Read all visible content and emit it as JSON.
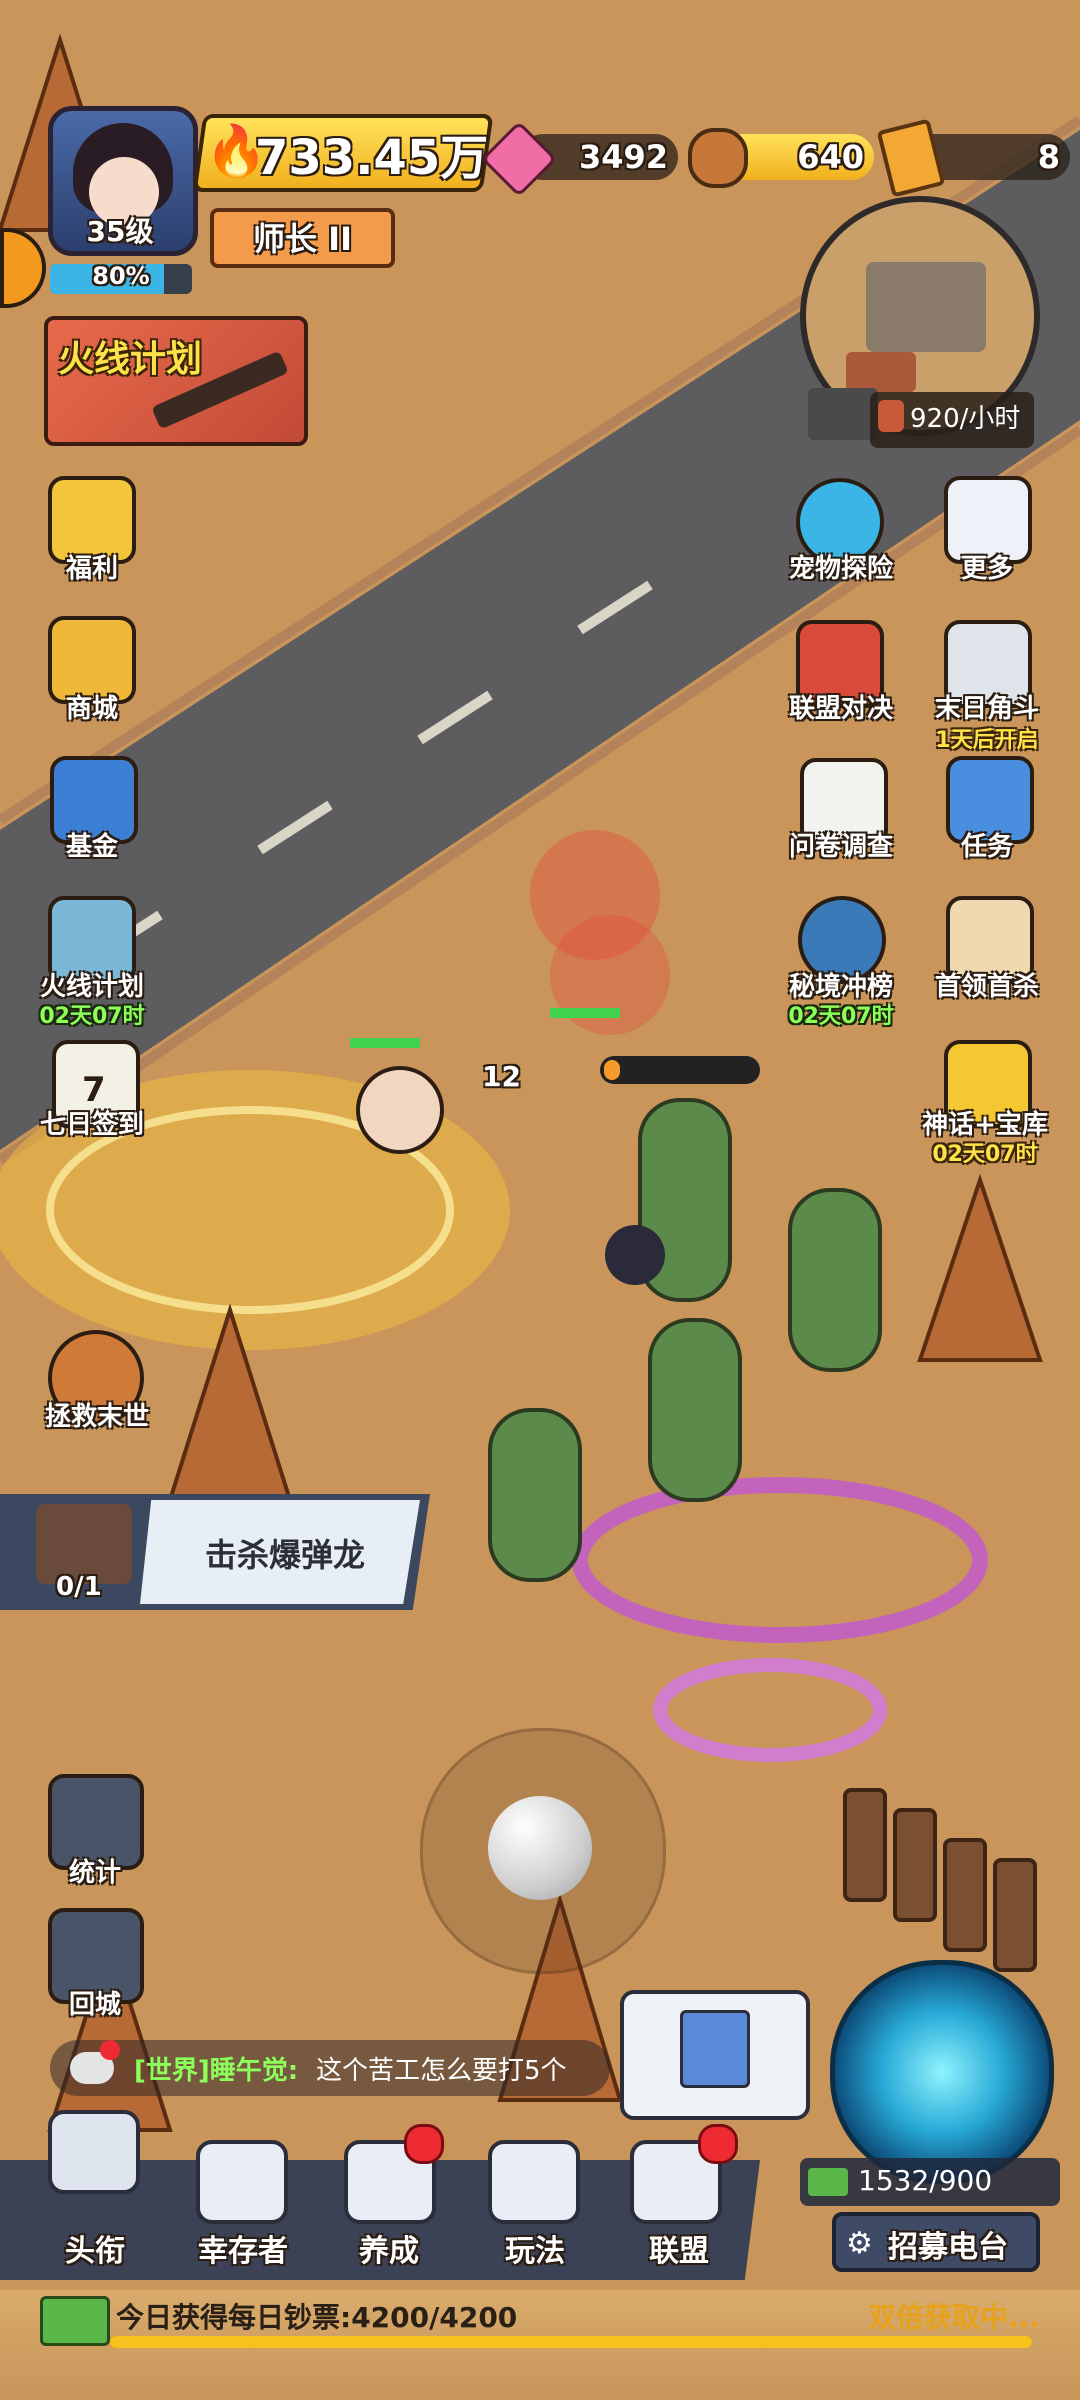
{
  "player": {
    "level": "35级",
    "xp_percent": 80,
    "xp_label": "80%",
    "power": "733.45万",
    "rank": "师长 II"
  },
  "resources": {
    "gems": "3492",
    "wood": "640",
    "tickets": "8"
  },
  "event_banner": {
    "title": "火线计划"
  },
  "left_menu": [
    {
      "label": "福利"
    },
    {
      "label": "商城"
    },
    {
      "label": "基金"
    },
    {
      "label": "火线计划",
      "timer": "02天07时"
    },
    {
      "label": "七日签到"
    }
  ],
  "right_menu": [
    {
      "label": "宠物探险"
    },
    {
      "label": "更多"
    },
    {
      "label": "联盟对决"
    },
    {
      "label": "末日角斗",
      "timer": "1天后开启"
    },
    {
      "label": "问卷调查"
    },
    {
      "label": "任务"
    },
    {
      "label": "秘境冲榜",
      "timer": "02天07时"
    },
    {
      "label": "首领首杀"
    },
    {
      "label": "神话+宝库",
      "timer": "02天07时"
    }
  ],
  "minimap": {
    "rate": "920/小时"
  },
  "rescue": {
    "label": "拯救末世"
  },
  "quest": {
    "text": "击杀爆弹龙",
    "progress": "0/1"
  },
  "battle": {
    "damage": "12"
  },
  "side_tools": [
    {
      "label": "统计"
    },
    {
      "label": "回城"
    }
  ],
  "chat": {
    "channel": "[世界]睡午觉:",
    "message": "这个苦工怎么要打5个"
  },
  "bottom_nav": [
    {
      "label": "头衔",
      "dot": false
    },
    {
      "label": "幸存者",
      "dot": false
    },
    {
      "label": "养成",
      "dot": true
    },
    {
      "label": "玩法",
      "dot": false
    },
    {
      "label": "联盟",
      "dot": true
    }
  ],
  "recruit": {
    "count": "1532/900",
    "button": "招募电台"
  },
  "daily": {
    "text": "今日获得每日钞票:4200/4200",
    "fraction": 1.0,
    "status": "双倍获取中..."
  },
  "colors": {
    "accent_yellow": "#ffe14a",
    "timer_green": "#8dff5a",
    "badge_red": "#ee2b33"
  }
}
